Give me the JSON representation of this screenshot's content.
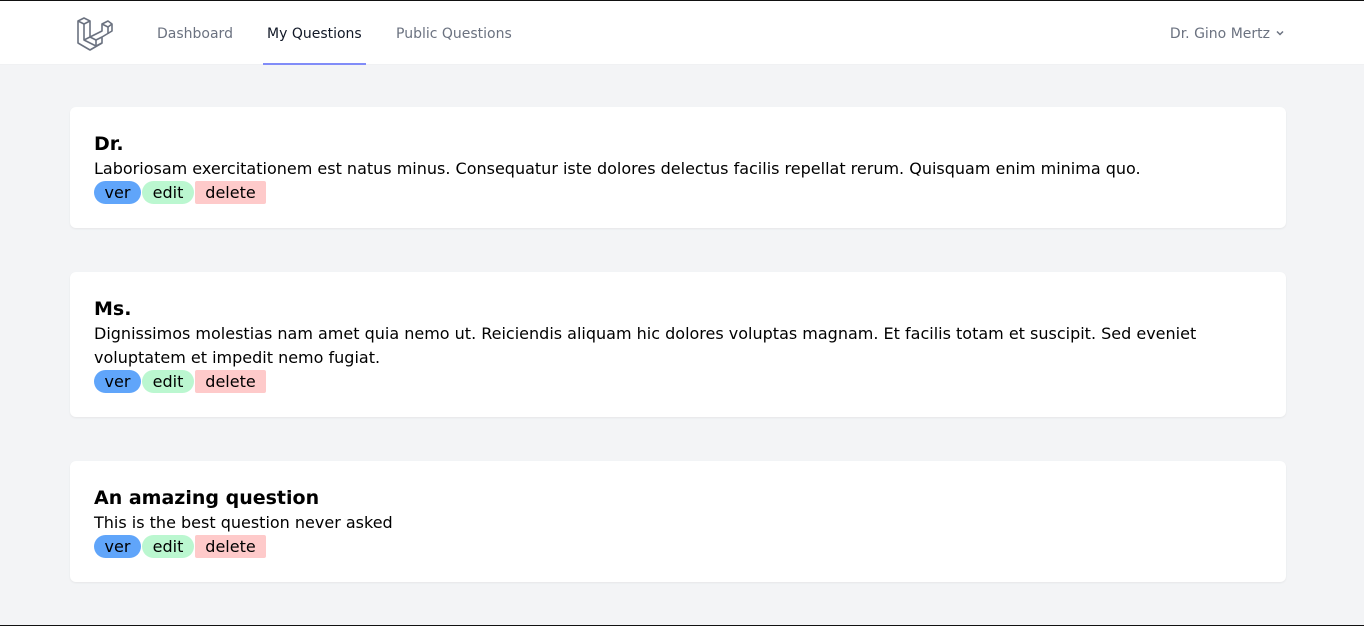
{
  "nav": {
    "links": [
      {
        "label": "Dashboard"
      },
      {
        "label": "My Questions"
      },
      {
        "label": "Public Questions"
      }
    ],
    "active": "My Questions",
    "user_name": "Dr. Gino Mertz"
  },
  "questions": [
    {
      "title": "Dr.",
      "body": "Laboriosam exercitationem est natus minus. Consequatur iste dolores delectus facilis repellat rerum. Quisquam enim minima quo.",
      "actions": {
        "view": "ver",
        "edit": "edit",
        "delete": "delete"
      }
    },
    {
      "title": "Ms.",
      "body": "Dignissimos molestias nam amet quia nemo ut. Reiciendis aliquam hic dolores voluptas magnam. Et facilis totam et suscipit. Sed eveniet voluptatem et impedit nemo fugiat.",
      "actions": {
        "view": "ver",
        "edit": "edit",
        "delete": "delete"
      }
    },
    {
      "title": "An amazing question",
      "body": "This is the best question never asked",
      "actions": {
        "view": "ver",
        "edit": "edit",
        "delete": "delete"
      }
    }
  ],
  "colors": {
    "view_button": "#60a5fa",
    "edit_button": "#bbf7d0",
    "delete_button": "#fecaca",
    "active_tab_underline": "#818cf8"
  }
}
